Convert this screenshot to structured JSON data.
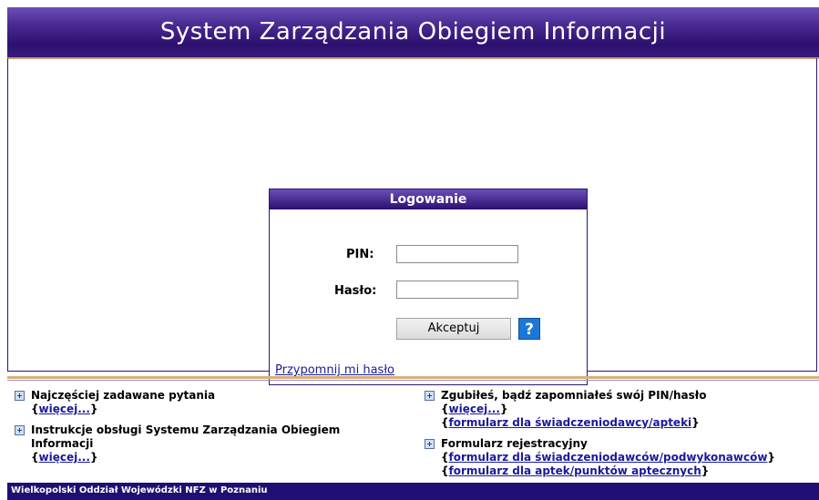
{
  "header": {
    "title": "System Zarządzania Obiegiem Informacji"
  },
  "login": {
    "title": "Logowanie",
    "pin_label": "PIN:",
    "password_label": "Hasło:",
    "accept_label": "Akceptuj",
    "help_icon": "?",
    "remind_link": "Przypomnij mi hasło",
    "pin_value": "",
    "password_value": ""
  },
  "links": {
    "faq": {
      "title": "Najczęściej zadawane pytania",
      "more": "więcej..."
    },
    "instructions": {
      "title_line1": "Instrukcje obsługi Systemu Zarządzania Obiegiem",
      "title_line2": "Informacji",
      "more": "więcej..."
    },
    "lost_pin": {
      "title": "Zgubiłeś, bądź zapomniałeś swój PIN/hasło",
      "more": "więcej...",
      "form": "formularz dla świadczeniodawcy/apteki"
    },
    "registration": {
      "title": "Formularz rejestracyjny",
      "form1": "formularz dla świadczeniodawców/podwykonawców",
      "form2": "formularz dla aptek/punktów aptecznych"
    },
    "expand_icon": "plus-square-icon"
  },
  "footer": {
    "text": "Wielkopolski Oddział Wojewódzki NFZ w Poznaniu"
  }
}
